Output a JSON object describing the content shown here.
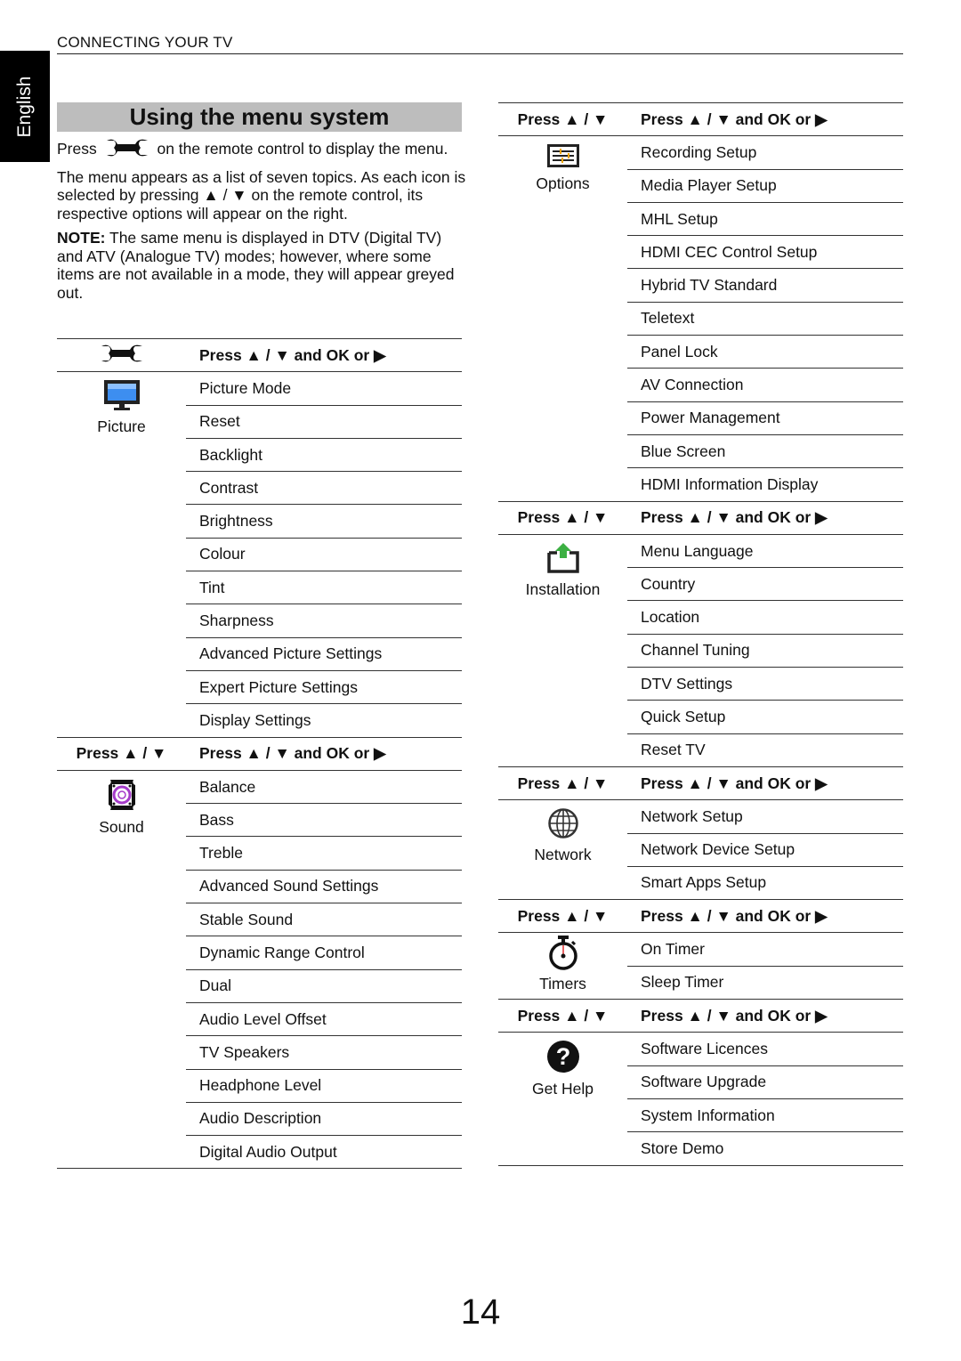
{
  "page": {
    "section_header": "CONNECTING YOUR TV",
    "language_tab": "English",
    "title": "Using the menu system",
    "page_number": "14"
  },
  "intro": {
    "press_prefix": "Press",
    "press_suffix": "on the remote control to display the menu.",
    "menu_icon": "wrench-icon",
    "para1": "The menu appears as a list of seven topics. As each icon is selected by pressing ▲ / ▼ on the remote control, its respective options will appear on the right.",
    "note_label": "NOTE:",
    "note_text": " The same menu is displayed in DTV (Digital TV) and ATV (Analogue TV) modes; however, where some items are not available in a mode, they will appear greyed out."
  },
  "headers": {
    "left": "Press ▲ / ▼",
    "right": "Press ▲ / ▼ and OK or ▶"
  },
  "categories": {
    "picture": {
      "label": "Picture",
      "icon": "tv-monitor-icon",
      "items": [
        "Picture Mode",
        "Reset",
        "Backlight",
        "Contrast",
        "Brightness",
        "Colour",
        "Tint",
        "Sharpness",
        "Advanced Picture Settings",
        "Expert Picture Settings",
        "Display Settings"
      ]
    },
    "sound": {
      "label": "Sound",
      "icon": "speaker-icon",
      "items": [
        "Balance",
        "Bass",
        "Treble",
        "Advanced Sound Settings",
        "Stable Sound",
        "Dynamic Range Control",
        "Dual",
        "Audio Level Offset",
        "TV Speakers",
        "Headphone Level",
        "Audio Description",
        "Digital Audio Output"
      ]
    },
    "options": {
      "label": "Options",
      "icon": "options-sliders-icon",
      "items": [
        "Recording Setup",
        "Media Player Setup",
        "MHL Setup",
        "HDMI CEC Control Setup",
        "Hybrid TV Standard",
        "Teletext",
        "Panel Lock",
        "AV Connection",
        "Power Management",
        "Blue Screen",
        "HDMI Information Display"
      ]
    },
    "installation": {
      "label": "Installation",
      "icon": "installation-upload-icon",
      "items": [
        "Menu Language",
        "Country",
        "Location",
        "Channel Tuning",
        "DTV Settings",
        "Quick Setup",
        "Reset TV"
      ]
    },
    "network": {
      "label": "Network",
      "icon": "globe-icon",
      "items": [
        "Network Setup",
        "Network Device Setup",
        "Smart Apps Setup"
      ]
    },
    "timers": {
      "label": "Timers",
      "icon": "stopwatch-icon",
      "items": [
        "On Timer",
        "Sleep Timer"
      ]
    },
    "help": {
      "label": "Get Help",
      "icon": "question-mark-icon",
      "items": [
        "Software Licences",
        "Software Upgrade",
        "System Information",
        "Store Demo"
      ]
    }
  },
  "colors": {
    "title_bar": "#bdbdbd",
    "picture_screen": "#3d8ef0",
    "sound_accent": "#a53bc9",
    "options_accent": "#f0a500",
    "installation_arrow": "#3cb043",
    "timer_hand": "#e03030"
  }
}
